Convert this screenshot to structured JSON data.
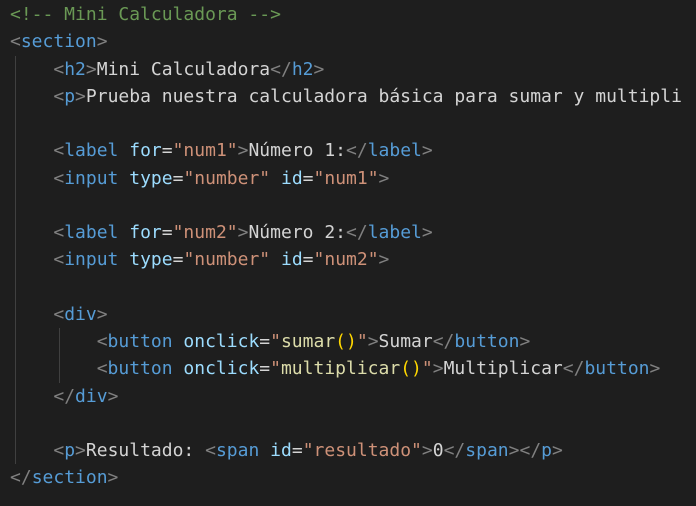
{
  "code_lines": [
    {
      "indent": 0,
      "tokens": [
        {
          "t": "<!-- Mini Calculadora -->",
          "c": "comment"
        }
      ]
    },
    {
      "indent": 0,
      "tokens": [
        {
          "t": "<",
          "c": "bracket"
        },
        {
          "t": "section",
          "c": "tag"
        },
        {
          "t": ">",
          "c": "bracket"
        }
      ]
    },
    {
      "indent": 1,
      "tokens": [
        {
          "t": "<",
          "c": "bracket"
        },
        {
          "t": "h2",
          "c": "tag"
        },
        {
          "t": ">",
          "c": "bracket"
        },
        {
          "t": "Mini Calculadora",
          "c": "text"
        },
        {
          "t": "</",
          "c": "bracket"
        },
        {
          "t": "h2",
          "c": "tag"
        },
        {
          "t": ">",
          "c": "bracket"
        }
      ]
    },
    {
      "indent": 1,
      "tokens": [
        {
          "t": "<",
          "c": "bracket"
        },
        {
          "t": "p",
          "c": "tag"
        },
        {
          "t": ">",
          "c": "bracket"
        },
        {
          "t": "Prueba nuestra calculadora básica para sumar y multipli",
          "c": "text"
        }
      ]
    },
    {
      "indent": 0,
      "tokens": []
    },
    {
      "indent": 1,
      "tokens": [
        {
          "t": "<",
          "c": "bracket"
        },
        {
          "t": "label",
          "c": "tag"
        },
        {
          "t": " ",
          "c": "text"
        },
        {
          "t": "for",
          "c": "attr"
        },
        {
          "t": "=",
          "c": "text"
        },
        {
          "t": "\"num1\"",
          "c": "string"
        },
        {
          "t": ">",
          "c": "bracket"
        },
        {
          "t": "Número 1:",
          "c": "text"
        },
        {
          "t": "</",
          "c": "bracket"
        },
        {
          "t": "label",
          "c": "tag"
        },
        {
          "t": ">",
          "c": "bracket"
        }
      ]
    },
    {
      "indent": 1,
      "tokens": [
        {
          "t": "<",
          "c": "bracket"
        },
        {
          "t": "input",
          "c": "tag"
        },
        {
          "t": " ",
          "c": "text"
        },
        {
          "t": "type",
          "c": "attr"
        },
        {
          "t": "=",
          "c": "text"
        },
        {
          "t": "\"number\"",
          "c": "string"
        },
        {
          "t": " ",
          "c": "text"
        },
        {
          "t": "id",
          "c": "attr"
        },
        {
          "t": "=",
          "c": "text"
        },
        {
          "t": "\"num1\"",
          "c": "string"
        },
        {
          "t": ">",
          "c": "bracket"
        }
      ]
    },
    {
      "indent": 0,
      "tokens": []
    },
    {
      "indent": 1,
      "tokens": [
        {
          "t": "<",
          "c": "bracket"
        },
        {
          "t": "label",
          "c": "tag"
        },
        {
          "t": " ",
          "c": "text"
        },
        {
          "t": "for",
          "c": "attr"
        },
        {
          "t": "=",
          "c": "text"
        },
        {
          "t": "\"num2\"",
          "c": "string"
        },
        {
          "t": ">",
          "c": "bracket"
        },
        {
          "t": "Número 2:",
          "c": "text"
        },
        {
          "t": "</",
          "c": "bracket"
        },
        {
          "t": "label",
          "c": "tag"
        },
        {
          "t": ">",
          "c": "bracket"
        }
      ]
    },
    {
      "indent": 1,
      "tokens": [
        {
          "t": "<",
          "c": "bracket"
        },
        {
          "t": "input",
          "c": "tag"
        },
        {
          "t": " ",
          "c": "text"
        },
        {
          "t": "type",
          "c": "attr"
        },
        {
          "t": "=",
          "c": "text"
        },
        {
          "t": "\"number\"",
          "c": "string"
        },
        {
          "t": " ",
          "c": "text"
        },
        {
          "t": "id",
          "c": "attr"
        },
        {
          "t": "=",
          "c": "text"
        },
        {
          "t": "\"num2\"",
          "c": "string"
        },
        {
          "t": ">",
          "c": "bracket"
        }
      ]
    },
    {
      "indent": 0,
      "tokens": []
    },
    {
      "indent": 1,
      "tokens": [
        {
          "t": "<",
          "c": "bracket"
        },
        {
          "t": "div",
          "c": "tag"
        },
        {
          "t": ">",
          "c": "bracket"
        }
      ]
    },
    {
      "indent": 2,
      "tokens": [
        {
          "t": "<",
          "c": "bracket"
        },
        {
          "t": "button",
          "c": "tag"
        },
        {
          "t": " ",
          "c": "text"
        },
        {
          "t": "onclick",
          "c": "attr"
        },
        {
          "t": "=",
          "c": "text"
        },
        {
          "t": "\"",
          "c": "string"
        },
        {
          "t": "sumar",
          "c": "func"
        },
        {
          "t": "()",
          "c": "paren"
        },
        {
          "t": "\"",
          "c": "string"
        },
        {
          "t": ">",
          "c": "bracket"
        },
        {
          "t": "Sumar",
          "c": "text"
        },
        {
          "t": "</",
          "c": "bracket"
        },
        {
          "t": "button",
          "c": "tag"
        },
        {
          "t": ">",
          "c": "bracket"
        }
      ]
    },
    {
      "indent": 2,
      "tokens": [
        {
          "t": "<",
          "c": "bracket"
        },
        {
          "t": "button",
          "c": "tag"
        },
        {
          "t": " ",
          "c": "text"
        },
        {
          "t": "onclick",
          "c": "attr"
        },
        {
          "t": "=",
          "c": "text"
        },
        {
          "t": "\"",
          "c": "string"
        },
        {
          "t": "multiplicar",
          "c": "func"
        },
        {
          "t": "()",
          "c": "paren"
        },
        {
          "t": "\"",
          "c": "string"
        },
        {
          "t": ">",
          "c": "bracket"
        },
        {
          "t": "Multiplicar",
          "c": "text"
        },
        {
          "t": "</",
          "c": "bracket"
        },
        {
          "t": "button",
          "c": "tag"
        },
        {
          "t": ">",
          "c": "bracket"
        }
      ]
    },
    {
      "indent": 1,
      "tokens": [
        {
          "t": "</",
          "c": "bracket"
        },
        {
          "t": "div",
          "c": "tag"
        },
        {
          "t": ">",
          "c": "bracket"
        }
      ]
    },
    {
      "indent": 0,
      "tokens": []
    },
    {
      "indent": 1,
      "tokens": [
        {
          "t": "<",
          "c": "bracket"
        },
        {
          "t": "p",
          "c": "tag"
        },
        {
          "t": ">",
          "c": "bracket"
        },
        {
          "t": "Resultado: ",
          "c": "text"
        },
        {
          "t": "<",
          "c": "bracket"
        },
        {
          "t": "span",
          "c": "tag"
        },
        {
          "t": " ",
          "c": "text"
        },
        {
          "t": "id",
          "c": "attr"
        },
        {
          "t": "=",
          "c": "text"
        },
        {
          "t": "\"resultado\"",
          "c": "string"
        },
        {
          "t": ">",
          "c": "bracket"
        },
        {
          "t": "0",
          "c": "text"
        },
        {
          "t": "</",
          "c": "bracket"
        },
        {
          "t": "span",
          "c": "tag"
        },
        {
          "t": ">",
          "c": "bracket"
        },
        {
          "t": "</",
          "c": "bracket"
        },
        {
          "t": "p",
          "c": "tag"
        },
        {
          "t": ">",
          "c": "bracket"
        }
      ]
    },
    {
      "indent": 0,
      "tokens": [
        {
          "t": "</",
          "c": "bracket"
        },
        {
          "t": "section",
          "c": "tag"
        },
        {
          "t": ">",
          "c": "bracket"
        }
      ]
    }
  ],
  "colors": {
    "background": "#1e1e1e",
    "comment": "#6a9955",
    "bracket": "#808080",
    "tag": "#569cd6",
    "attr": "#9cdcfe",
    "string": "#ce9178",
    "text": "#d4d4d4",
    "func": "#dcdcaa",
    "paren": "#ffd700",
    "indent_guide": "#404040"
  }
}
